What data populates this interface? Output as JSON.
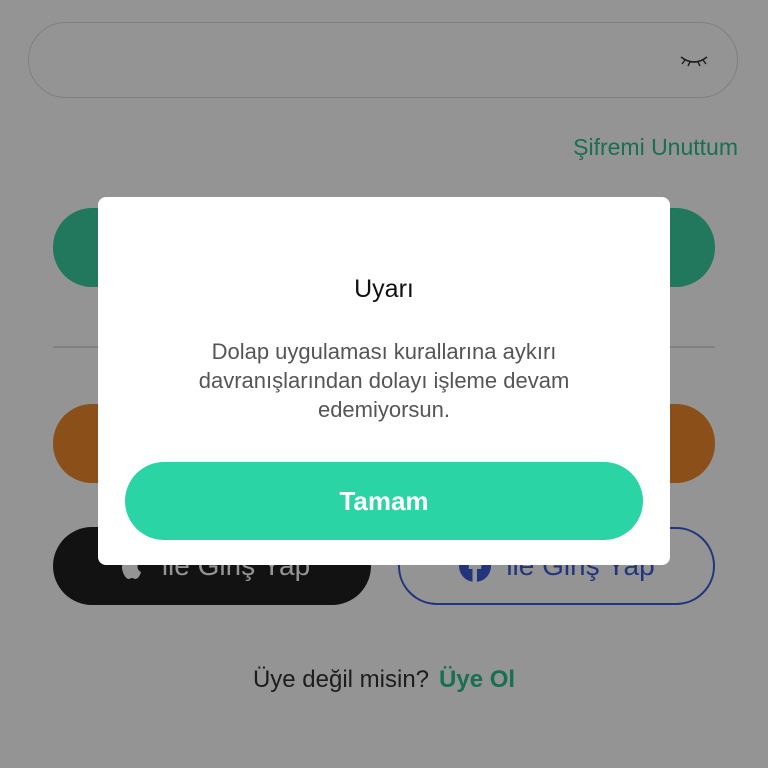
{
  "login": {
    "password_value": "",
    "forgot_password": "Şifremi Unuttum",
    "apple_login_label": "ile Giriş Yap",
    "facebook_login_label": "ile Giriş Yap",
    "signup_prompt": "Üye değil misin?",
    "signup_link": "Üye Ol"
  },
  "dialog": {
    "title": "Uyarı",
    "message": "Dolap uygulaması kurallarına aykırı davranışlarından dolayı işleme devam edemiyorsun.",
    "ok_button": "Tamam"
  },
  "icons": {
    "password_toggle": "eye-closed-icon",
    "apple": "apple-icon",
    "facebook": "facebook-icon"
  },
  "colors": {
    "accent_green": "#2ad4a4",
    "link_green": "#2bbf8f",
    "orange": "#f08a2e",
    "facebook_blue": "#3b5ad6",
    "apple_black": "#1f1f1f",
    "overlay": "rgba(0,0,0,0.42)"
  }
}
